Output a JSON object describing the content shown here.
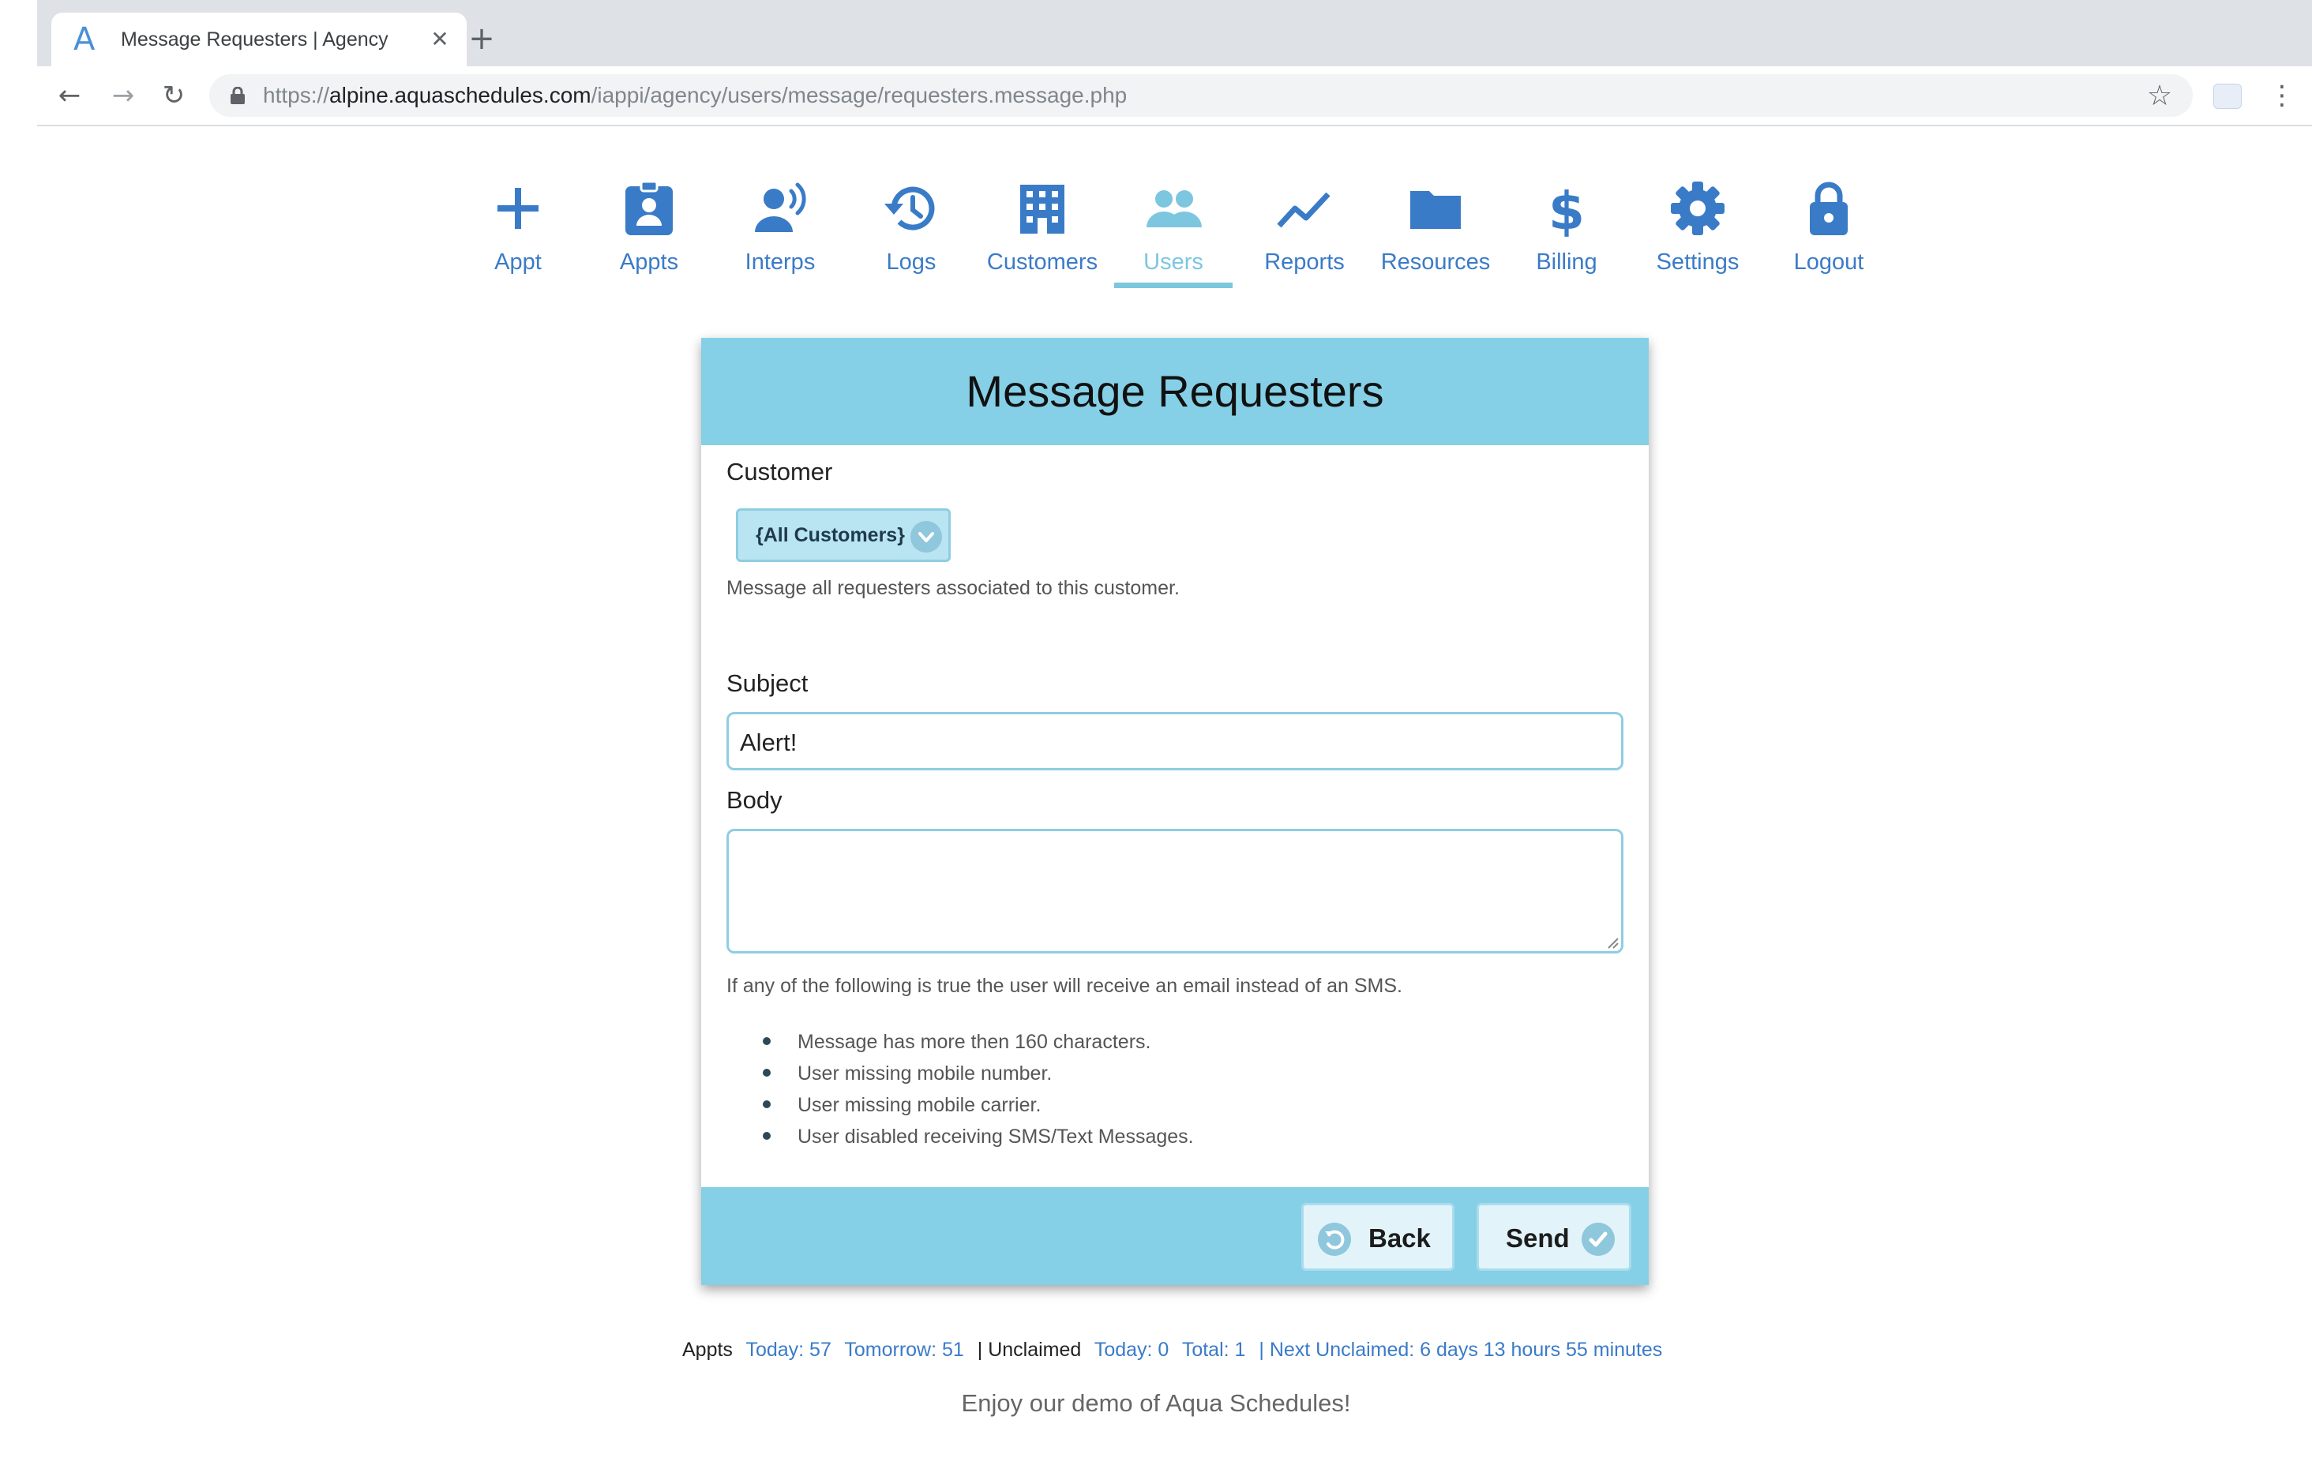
{
  "browser": {
    "tab_title": "Message Requesters | Agency",
    "url_scheme": "https://",
    "url_host": "alpine.aquaschedules.com",
    "url_path": "/iappi/agency/users/message/requesters.message.php"
  },
  "nav": {
    "items": [
      {
        "label": "Appt",
        "icon": "plus-icon"
      },
      {
        "label": "Appts",
        "icon": "clipboard-user-icon"
      },
      {
        "label": "Interps",
        "icon": "user-voice-icon"
      },
      {
        "label": "Logs",
        "icon": "history-icon"
      },
      {
        "label": "Customers",
        "icon": "building-icon"
      },
      {
        "label": "Users",
        "icon": "users-icon"
      },
      {
        "label": "Reports",
        "icon": "chart-line-icon"
      },
      {
        "label": "Resources",
        "icon": "folder-icon"
      },
      {
        "label": "Billing",
        "icon": "dollar-icon"
      },
      {
        "label": "Settings",
        "icon": "gear-icon"
      },
      {
        "label": "Logout",
        "icon": "lock-icon"
      }
    ],
    "active": "Users"
  },
  "form": {
    "title": "Message Requesters",
    "customer_label": "Customer",
    "customer_selected": "{All Customers}",
    "customer_help": "Message all requesters associated to this customer.",
    "subject_label": "Subject",
    "subject_value": "Alert!",
    "body_label": "Body",
    "body_value": "",
    "sms_note": "If any of the following is true the user will receive an email instead of an SMS.",
    "conditions": [
      "Message has more then 160 characters.",
      "User missing mobile number.",
      "User missing mobile carrier.",
      "User disabled receiving SMS/Text Messages."
    ],
    "back_label": "Back",
    "send_label": "Send"
  },
  "stats": {
    "appts_label": "Appts",
    "today": "Today: 57",
    "tomorrow": "Tomorrow: 51",
    "unclaimed_label": "| Unclaimed",
    "unclaimed_today": "Today: 0",
    "unclaimed_total": "Total: 1",
    "next_unclaimed": "| Next Unclaimed: 6 days 13 hours 55 minutes"
  },
  "tagline": "Enjoy our demo of Aqua Schedules!",
  "colors": {
    "header_bg": "#85d0e6",
    "nav_blue": "#3a7bc8",
    "active_nav": "#7cc6e0",
    "input_border": "#8fcde2"
  }
}
